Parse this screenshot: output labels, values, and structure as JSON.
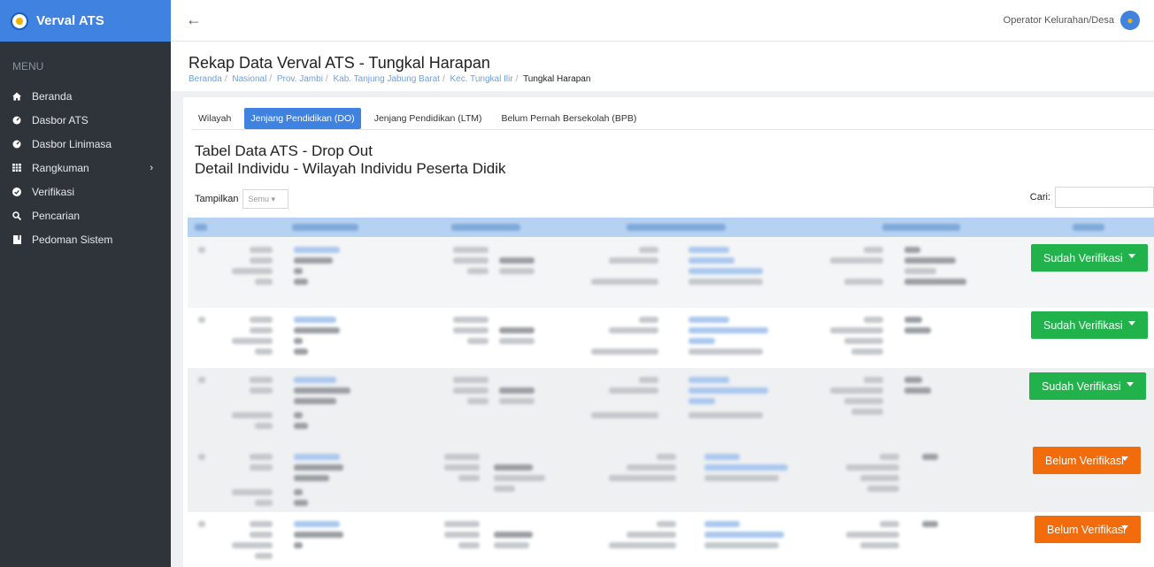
{
  "app": {
    "title": "Verval ATS"
  },
  "sidebar": {
    "menu_label": "MENU",
    "items": [
      {
        "label": "Beranda",
        "icon": "home-icon"
      },
      {
        "label": "Dasbor ATS",
        "icon": "dashboard-icon"
      },
      {
        "label": "Dasbor Linimasa",
        "icon": "dashboard-icon"
      },
      {
        "label": "Rangkuman",
        "icon": "grid-icon"
      },
      {
        "label": "Verifikasi",
        "icon": "check-circle-icon"
      },
      {
        "label": "Pencarian",
        "icon": "search-icon"
      },
      {
        "label": "Pedoman Sistem",
        "icon": "book-icon"
      }
    ]
  },
  "topbar": {
    "back_icon": "arrow-left-icon",
    "user_role": "Operator Kelurahan/Desa"
  },
  "header": {
    "title": "Rekap Data Verval ATS - Tungkal Harapan",
    "breadcrumb": [
      "Beranda",
      "Nasional",
      "Prov. Jambi",
      "Kab. Tanjung Jabung Barat",
      "Kec. Tungkal Ilir",
      "Tungkal Harapan"
    ]
  },
  "tabs": [
    "Wilayah",
    "Jenjang Pendidikan (DO)",
    "Jenjang Pendidikan (LTM)",
    "Belum Pernah Bersekolah (BPB)"
  ],
  "table": {
    "title": "Tabel Data ATS - Drop Out",
    "subtitle": "Detail Individu - Wilayah Individu Peserta Didik",
    "show_label": "Tampilkan",
    "show_value": "Semu",
    "search_label": "Cari:"
  },
  "rows": [
    {
      "status_button": "Sudah Verifikasi",
      "status_color": "#21b24b"
    },
    {
      "status_button": "Sudah Verifikasi",
      "status_color": "#21b24b"
    },
    {
      "status_button": "Sudah Verifikasi",
      "status_color": "#21b24b"
    },
    {
      "status_button": "Belum Verifikasi",
      "status_color": "#f36c0c"
    },
    {
      "status_button": "Belum Verifikasi",
      "status_color": "#f36c0c"
    }
  ],
  "colors": {
    "sidebar": "#2f343a",
    "brand": "#3f82e0",
    "active_tab": "#3f82e0",
    "header_row": "#b6d2f2"
  }
}
